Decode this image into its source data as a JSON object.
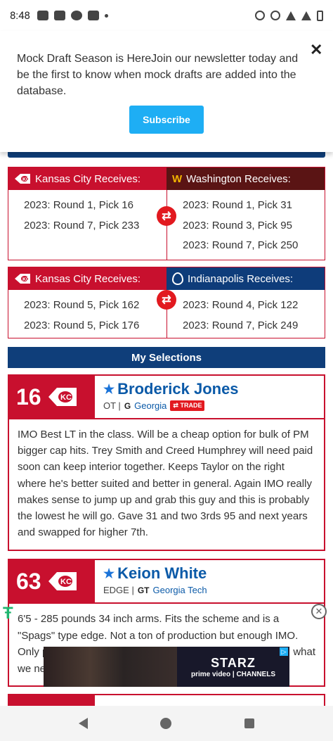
{
  "status_bar": {
    "time": "8:48"
  },
  "newsletter": {
    "message": "Mock Draft Season is HereJoin our newsletter today and be the first to know when mock drafts are added into the database.",
    "subscribe_label": "Subscribe",
    "close_label": "✕"
  },
  "trades": [
    {
      "left_header": "Kansas City Receives:",
      "right_header": "Washington Receives:",
      "right_logo": "W",
      "left_picks": [
        "2023: Round 1, Pick 16",
        "2023: Round 7, Pick 233"
      ],
      "right_picks": [
        "2023: Round 1, Pick 31",
        "2023: Round 3, Pick 95",
        "2023: Round 7, Pick 250"
      ]
    },
    {
      "left_header": "Kansas City Receives:",
      "right_header": "Indianapolis Receives:",
      "left_picks": [
        "2023: Round 5, Pick 162",
        "2023: Round 5, Pick 176"
      ],
      "right_picks": [
        "2023: Round 4, Pick 122",
        "2023: Round 7, Pick 249"
      ]
    }
  ],
  "my_selections_label": "My Selections",
  "picks": [
    {
      "number": "16",
      "name": "Broderick Jones",
      "position": "OT |",
      "school_logo": "G",
      "school": "Georgia",
      "trade_badge": "⇄ TRADE",
      "description": "IMO Best LT in the class. Will be a cheap option for bulk of PM bigger cap hits. Trey Smith and Creed Humphrey will need paid soon can keep interior together. Keeps Taylor on the right where he's better suited and better in general. Again IMO really makes sense to jump up and grab this guy and this is probably the lowest he will go. Gave 31 and two 3rds 95 and next years and swapped for higher 7th."
    },
    {
      "number": "63",
      "name": "Keion White",
      "position": "EDGE |",
      "school_logo": "GT",
      "school": "Georgia Tech",
      "description_lines": [
        "6'5 - 285 pounds 34 inch arms. Fits the scheme and is a",
        "\"Spags\" type edge. Not a ton of production but enough IMO.",
        "Only p",
        "what",
        "we ne"
      ]
    }
  ],
  "ad": {
    "brand": "STARZ",
    "sub": "prime video | CHANNELS",
    "close_label": "✕",
    "logo": "Ŧ"
  },
  "colors": {
    "chiefs_red": "#c8102e",
    "navy": "#0f3e7a",
    "washington": "#5a1414",
    "link_blue": "#0b5aa8",
    "subscribe": "#1eaef4"
  }
}
